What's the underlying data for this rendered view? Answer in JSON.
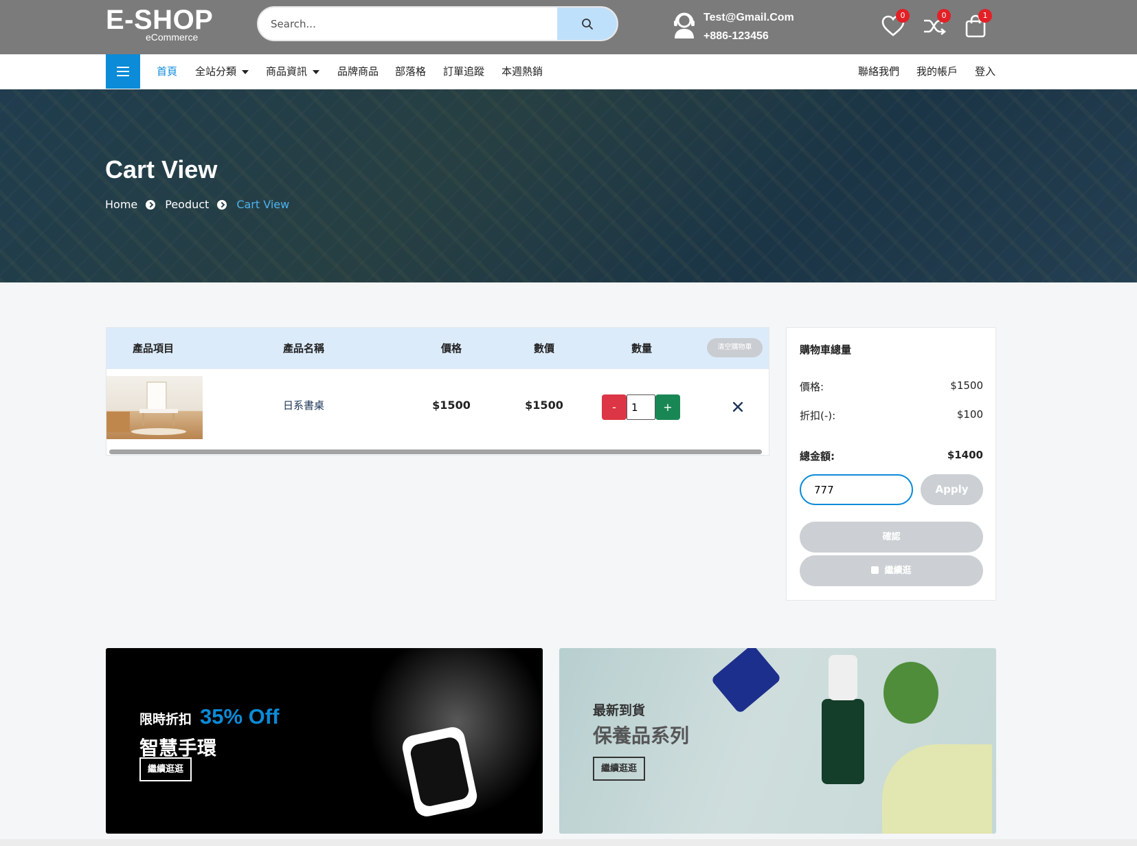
{
  "header": {
    "logo_main": "E-SHOP",
    "logo_sub": "eCommerce",
    "search_placeholder": "Search...",
    "email": "Test@Gmail.Com",
    "phone": "+886-123456",
    "wishlist_count": "0",
    "compare_count": "0",
    "cart_count": "1"
  },
  "nav": {
    "items": [
      {
        "label": "首頁"
      },
      {
        "label": "全站分類"
      },
      {
        "label": "商品資訊"
      },
      {
        "label": "品牌商品"
      },
      {
        "label": "部落格"
      },
      {
        "label": "訂單追蹤"
      },
      {
        "label": "本週熱銷"
      }
    ],
    "right_items": [
      {
        "label": "聯絡我們"
      },
      {
        "label": "我的帳戶"
      },
      {
        "label": "登入"
      }
    ]
  },
  "hero": {
    "title": "Cart View",
    "breadcrumb": [
      "Home",
      "Peoduct",
      "Cart View"
    ]
  },
  "cart": {
    "columns": [
      "產品項目",
      "產品名稱",
      "價格",
      "數價",
      "數量"
    ],
    "clear_label": "清空購物車",
    "items": [
      {
        "name": "日系書桌",
        "price": "$1500",
        "subtotal": "$1500",
        "qty": "1"
      }
    ],
    "minus_label": "-",
    "plus_label": "+"
  },
  "summary": {
    "title": "購物車總量",
    "price_label": "價格:",
    "price_value": "$1500",
    "discount_label": "折扣(-):",
    "discount_value": "$100",
    "total_label": "總金額:",
    "total_value": "$1400",
    "coupon_value": "777",
    "apply_label": "Apply",
    "confirm_label": "確認",
    "continue_label": "繼續逛"
  },
  "banners": [
    {
      "small": "限時折扣",
      "highlight": "35% Off",
      "big": "智慧手環",
      "button": "繼續逛逛"
    },
    {
      "small": "最新到貨",
      "big": "保養品系列",
      "button": "繼續逛逛"
    }
  ],
  "colors": {
    "accent": "#0b8bd8",
    "header_bg": "#7b7b7b",
    "minus": "#dc3545",
    "plus": "#198754"
  }
}
